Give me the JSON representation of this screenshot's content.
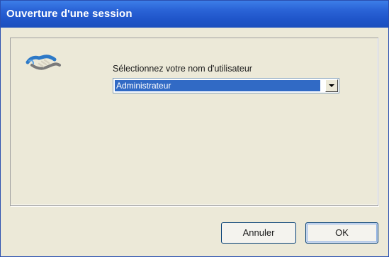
{
  "window": {
    "title": "Ouverture d'une session"
  },
  "login": {
    "prompt": "Sélectionnez votre nom d'utilisateur",
    "selected_user": "Administrateur"
  },
  "buttons": {
    "cancel_label": "Annuler",
    "ok_label": "OK"
  },
  "icons": {
    "logo": "handshake-icon",
    "dropdown": "chevron-down-icon"
  },
  "colors": {
    "titlebar": "#1f55c9",
    "selection": "#316ac5",
    "dialog_bg": "#ece9d8"
  }
}
